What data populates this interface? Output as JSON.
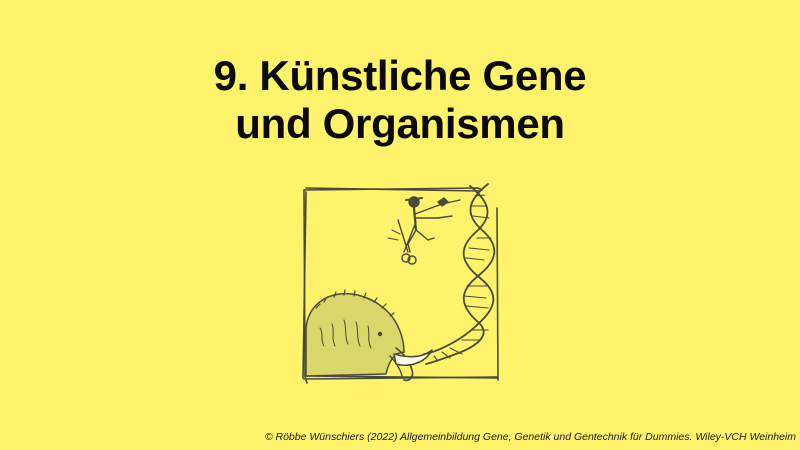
{
  "slide": {
    "title_line1": "9. Künstliche Gene",
    "title_line2": "und Organismen",
    "copyright": "© Röbbe Wünschiers (2022) Allgemeinbildung Gene, Genetik und Gentechnik für Dummies. Wiley-VCH Weinheim"
  },
  "illustration": {
    "icons": [
      "mammoth-icon",
      "dna-helix-icon",
      "scientist-icon",
      "scissors-icon"
    ]
  },
  "colors": {
    "background": "#fef36a",
    "text": "#0a0a0a",
    "sketch_line": "#4a4a3a",
    "mammoth_fill": "#d9d66a"
  }
}
